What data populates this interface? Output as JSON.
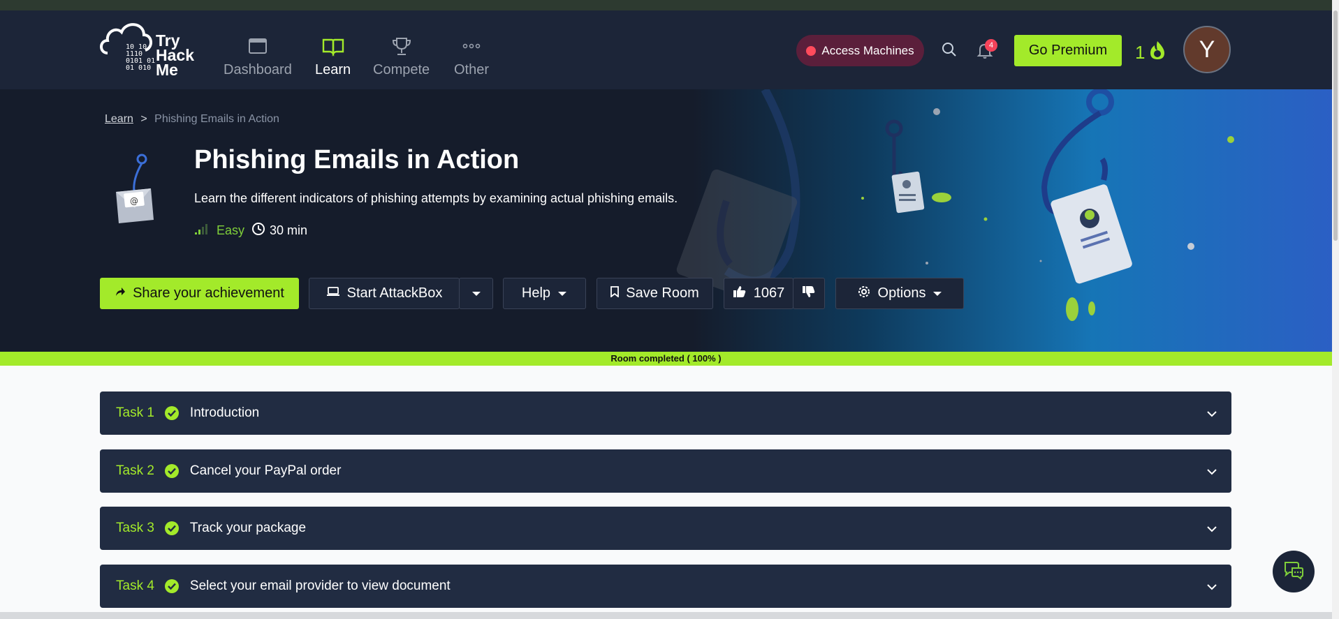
{
  "nav": {
    "logo_lines": [
      "Try",
      "Hack",
      "Me"
    ],
    "logo_bits": [
      "10  10",
      "1110",
      "0101 01",
      "01  010"
    ],
    "items": [
      {
        "label": "Dashboard",
        "icon": "window-icon",
        "active": false
      },
      {
        "label": "Learn",
        "icon": "book-icon",
        "active": true
      },
      {
        "label": "Compete",
        "icon": "trophy-icon",
        "active": false
      },
      {
        "label": "Other",
        "icon": "more-dots-icon",
        "active": false
      }
    ],
    "access_label": "Access Machines",
    "notification_count": "4",
    "premium_label": "Go Premium",
    "streak": "1",
    "avatar_letter": "Y"
  },
  "breadcrumb": {
    "root": "Learn",
    "separator": ">",
    "current": "Phishing Emails in Action"
  },
  "room": {
    "title": "Phishing Emails in Action",
    "description": "Learn the different indicators of phishing attempts by examining actual phishing emails.",
    "difficulty": "Easy",
    "duration": "30 min"
  },
  "actions": {
    "share": "Share your achievement",
    "attackbox": "Start AttackBox",
    "help": "Help",
    "save": "Save Room",
    "likes": "1067",
    "options": "Options"
  },
  "progress": {
    "label": "Room completed ( 100% )",
    "percent": 100
  },
  "tasks": [
    {
      "num": "Task 1",
      "title": "Introduction"
    },
    {
      "num": "Task 2",
      "title": "Cancel your PayPal order"
    },
    {
      "num": "Task 3",
      "title": "Track your package"
    },
    {
      "num": "Task 4",
      "title": "Select your email provider to view document"
    }
  ],
  "colors": {
    "accent": "#a3ea2a",
    "nav_bg": "#1c2538",
    "task_bg": "#212c42",
    "access_bg": "#5b1f3b"
  }
}
